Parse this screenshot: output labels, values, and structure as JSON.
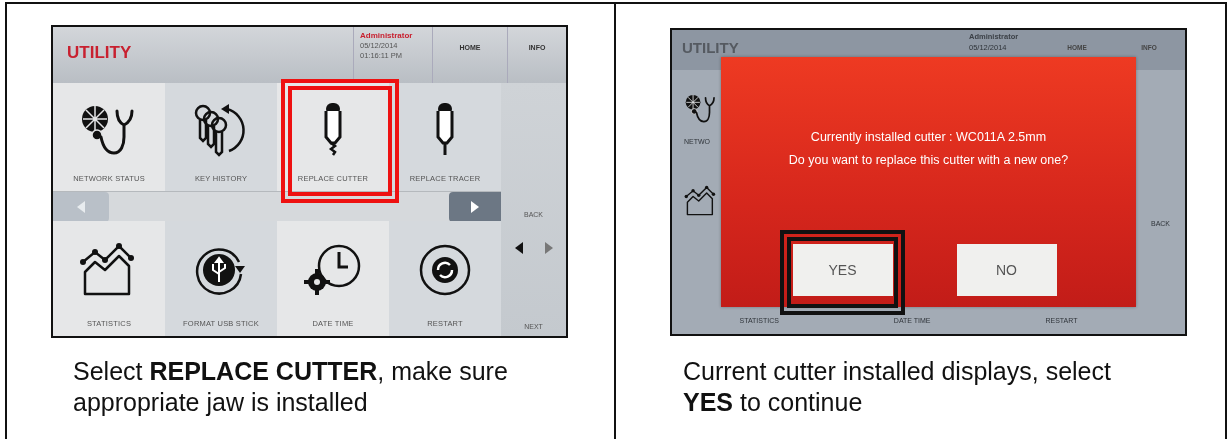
{
  "left_panel": {
    "screen": {
      "title": "UTILITY",
      "user": "Administrator",
      "date": "05/12/2014",
      "time": "01:16:11 PM",
      "nav": [
        "HOME",
        "INFO"
      ],
      "tiles_top": [
        {
          "kind": "network",
          "label": "NETWORK STATUS",
          "highlighted": false
        },
        {
          "kind": "keys",
          "label": "KEY HISTORY",
          "highlighted": false
        },
        {
          "kind": "cutter",
          "label": "REPLACE CUTTER",
          "highlighted": true
        },
        {
          "kind": "tracer",
          "label": "REPLACE TRACER",
          "highlighted": false
        }
      ],
      "tiles_bottom": [
        {
          "kind": "chart",
          "label": "STATISTICS",
          "highlighted": false
        },
        {
          "kind": "usb",
          "label": "FORMAT USB STICK",
          "highlighted": false
        },
        {
          "kind": "clock",
          "label": "DATE TIME",
          "highlighted": false
        },
        {
          "kind": "restart",
          "label": "RESTART",
          "highlighted": false
        }
      ],
      "back": "BACK",
      "next": "NEXT"
    },
    "caption": "Select **REPLACE CUTTER**, make sure appropriate jaw is installed"
  },
  "right_panel": {
    "screen": {
      "title": "UTILITY",
      "user": "Administrator",
      "date": "05/12/2014",
      "nav": [
        "HOME",
        "INFO"
      ],
      "partial_label": "NETWO",
      "back": "BACK",
      "bottom_labels": [
        "STATISTICS",
        "DATE TIME",
        "RESTART"
      ],
      "dialog": {
        "lines": [
          "Currently installed cutter : WC011A 2.5mm",
          "Do you want to replace this cutter with a new one?"
        ],
        "buttons": [
          {
            "label": "YES",
            "highlighted": true
          },
          {
            "label": "NO",
            "highlighted": false
          }
        ]
      }
    },
    "caption": "Current cutter installed displays, select **YES** to continue"
  }
}
